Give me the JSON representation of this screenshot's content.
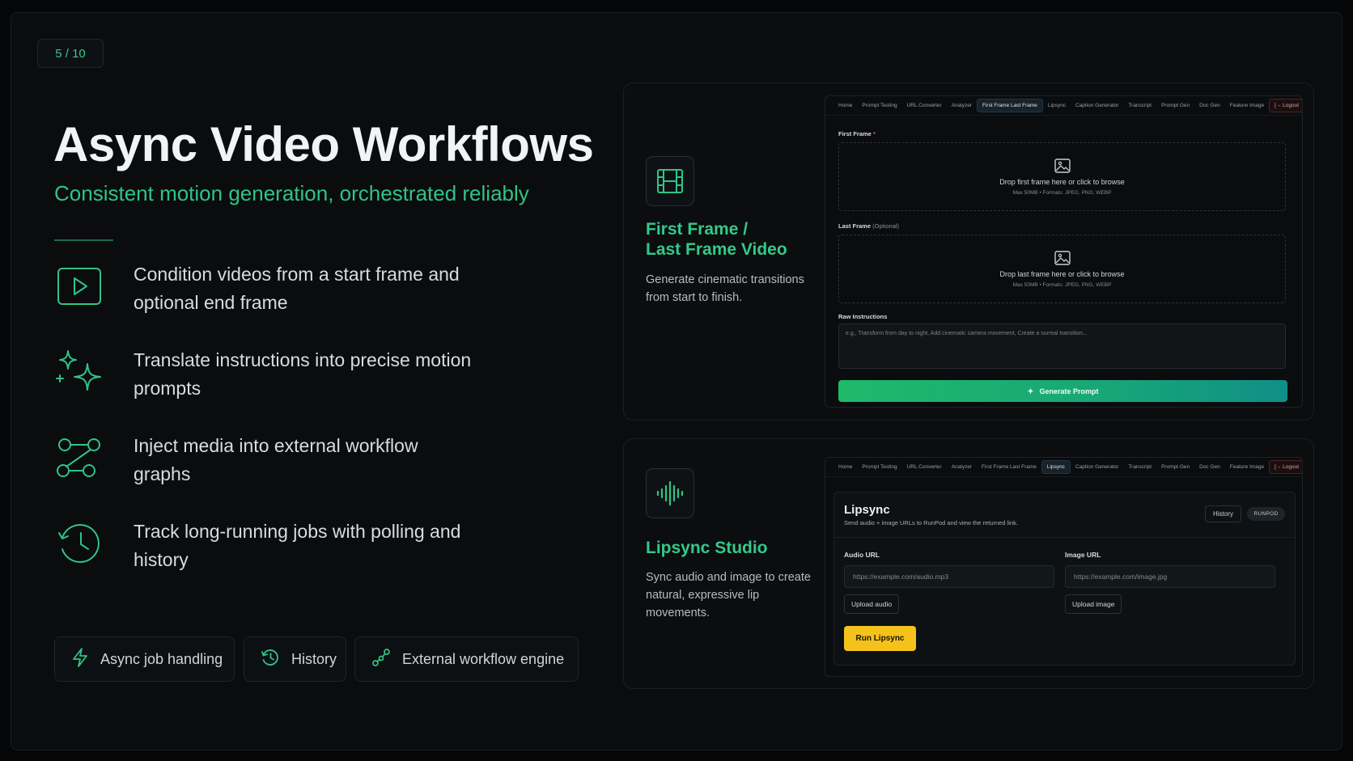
{
  "page_number": "5 / 10",
  "title": "Async Video Workflows",
  "subtitle": "Consistent motion generation, orchestrated reliably",
  "features": [
    {
      "icon": "play-icon",
      "text": "Condition videos from a start frame and optional end frame"
    },
    {
      "icon": "sparkles-icon",
      "text": "Translate instructions into precise motion prompts"
    },
    {
      "icon": "workflow-graph-icon",
      "text": "Inject media into external workflow graphs"
    },
    {
      "icon": "history-clock-icon",
      "text": "Track long-running jobs with polling and history"
    }
  ],
  "tags": [
    {
      "icon": "lightning-icon",
      "label": "Async job handling"
    },
    {
      "icon": "history-clock-icon",
      "label": "History"
    },
    {
      "icon": "workflow-icon",
      "label": "External workflow engine"
    }
  ],
  "nav_tabs": [
    "Home",
    "Prompt Testing",
    "URL Converter",
    "Analyzer",
    "First Frame Last Frame",
    "Lipsync",
    "Caption Generator",
    "Transcript",
    "Prompt Gen",
    "Doc Gen",
    "Feature Image"
  ],
  "logout_label": "Logout",
  "card1": {
    "icon": "film-icon",
    "title_line1": "First Frame /",
    "title_line2": "Last Frame Video",
    "description": "Generate cinematic transitions from start to finish.",
    "active_tab": 4,
    "first_frame_label": "First Frame",
    "required_mark": "*",
    "first_frame_drop": "Drop first frame here or click to browse",
    "last_frame_label": "Last Frame",
    "optional_mark": "(Optional)",
    "last_frame_drop": "Drop last frame here or click to browse",
    "drop_hint": "Max 50MB • Formats: JPEG, PNG, WEBP",
    "raw_instructions_label": "Raw Instructions",
    "raw_instructions_placeholder": "e.g., Transform from day to night, Add cinematic camera movement, Create a surreal transition...",
    "generate_label": "Generate Prompt"
  },
  "card2": {
    "icon": "audio-wave-icon",
    "title": "Lipsync Studio",
    "description": "Sync audio and image to create natural, expressive lip movements.",
    "active_tab": 5,
    "panel_title": "Lipsync",
    "panel_subtitle": "Send audio + image URLs to RunPod and view the returned link.",
    "history_label": "History",
    "runpod_badge": "RUNPOD",
    "audio_label": "Audio URL",
    "audio_placeholder": "https://example.com/audio.mp3",
    "upload_audio": "Upload audio",
    "image_label": "Image URL",
    "image_placeholder": "https://example.com/image.jpg",
    "upload_image": "Upload image",
    "run_label": "Run Lipsync"
  },
  "colors": {
    "accent": "#2fc486",
    "run_button": "#f4c21a",
    "background": "#0a0c0e"
  }
}
